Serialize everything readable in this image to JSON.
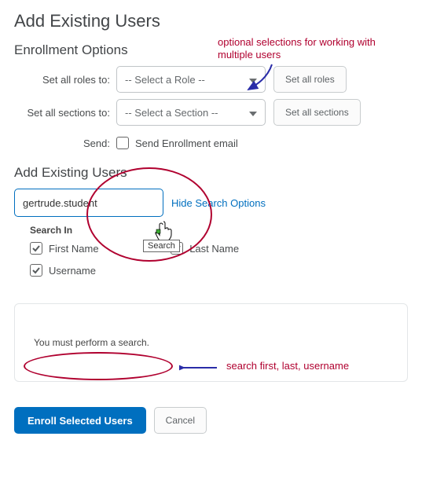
{
  "page_title": "Add Existing Users",
  "section_enroll_title": "Enrollment Options",
  "labels": {
    "roles": "Set all roles to:",
    "sections": "Set all sections to:",
    "send": "Send:"
  },
  "selects": {
    "role_placeholder": "-- Select a Role --",
    "section_placeholder": "-- Select a Section --"
  },
  "buttons": {
    "set_roles": "Set all roles",
    "set_sections": "Set all sections",
    "enroll": "Enroll Selected Users",
    "cancel": "Cancel"
  },
  "send_enroll_email": "Send Enrollment email",
  "section_add_title": "Add Existing Users",
  "search_value": "gertrude.student",
  "hide_search": "Hide Search Options",
  "search_in_legend": "Search In",
  "checks": {
    "first": "First Name",
    "last": "Last Name",
    "user": "Username"
  },
  "tooltip_search": "Search",
  "must_search": "You must perform a search.",
  "annotation_top": "optional selections for working with multiple users",
  "annotation_bottom": "search first, last, username"
}
